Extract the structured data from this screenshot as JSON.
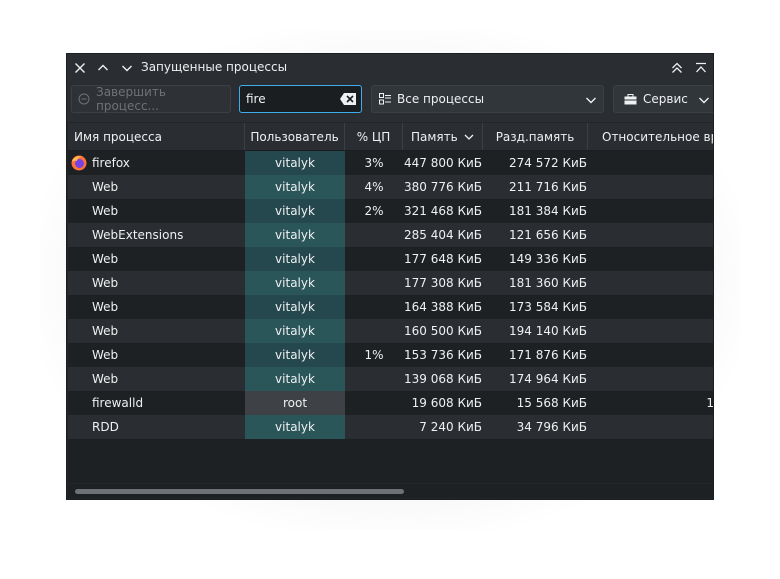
{
  "window": {
    "title": "Запущенные процессы"
  },
  "toolbar": {
    "kill_label": "Завершить процесс...",
    "search_value": "fire",
    "filter_label": "Все процессы",
    "tools_label": "Сервис"
  },
  "table": {
    "columns": [
      "Имя процесса",
      "Пользователь",
      "% ЦП",
      "Память",
      "Разд.память",
      "Относительное вр"
    ],
    "rows": [
      {
        "name": "firefox",
        "user": "vitalyk",
        "cpu": "3%",
        "mem": "447 800 КиБ",
        "shared": "274 572 КиБ",
        "rel": ""
      },
      {
        "name": "Web",
        "user": "vitalyk",
        "cpu": "4%",
        "mem": "380 776 КиБ",
        "shared": "211 716 КиБ",
        "rel": ""
      },
      {
        "name": "Web",
        "user": "vitalyk",
        "cpu": "2%",
        "mem": "321 468 КиБ",
        "shared": "181 384 КиБ",
        "rel": ""
      },
      {
        "name": "WebExtensions",
        "user": "vitalyk",
        "cpu": "",
        "mem": "285 404 КиБ",
        "shared": "121 656 КиБ",
        "rel": ""
      },
      {
        "name": "Web",
        "user": "vitalyk",
        "cpu": "",
        "mem": "177 648 КиБ",
        "shared": "149 336 КиБ",
        "rel": ""
      },
      {
        "name": "Web",
        "user": "vitalyk",
        "cpu": "",
        "mem": "177 308 КиБ",
        "shared": "181 360 КиБ",
        "rel": ""
      },
      {
        "name": "Web",
        "user": "vitalyk",
        "cpu": "",
        "mem": "164 388 КиБ",
        "shared": "173 584 КиБ",
        "rel": ""
      },
      {
        "name": "Web",
        "user": "vitalyk",
        "cpu": "",
        "mem": "160 500 КиБ",
        "shared": "194 140 КиБ",
        "rel": ""
      },
      {
        "name": "Web",
        "user": "vitalyk",
        "cpu": "1%",
        "mem": "153 736 КиБ",
        "shared": "171 876 КиБ",
        "rel": ""
      },
      {
        "name": "Web",
        "user": "vitalyk",
        "cpu": "",
        "mem": "139 068 КиБ",
        "shared": "174 964 КиБ",
        "rel": ""
      },
      {
        "name": "firewalld",
        "user": "root",
        "cpu": "",
        "mem": "19 608 КиБ",
        "shared": "15 568 КиБ",
        "rel": "1"
      },
      {
        "name": "RDD",
        "user": "vitalyk",
        "cpu": "",
        "mem": "7 240 КиБ",
        "shared": "34 796 КиБ",
        "rel": ""
      }
    ]
  },
  "colors": {
    "accent": "#3daee9",
    "user_highlight": "#2a5559",
    "root_highlight": "#474b4f"
  }
}
